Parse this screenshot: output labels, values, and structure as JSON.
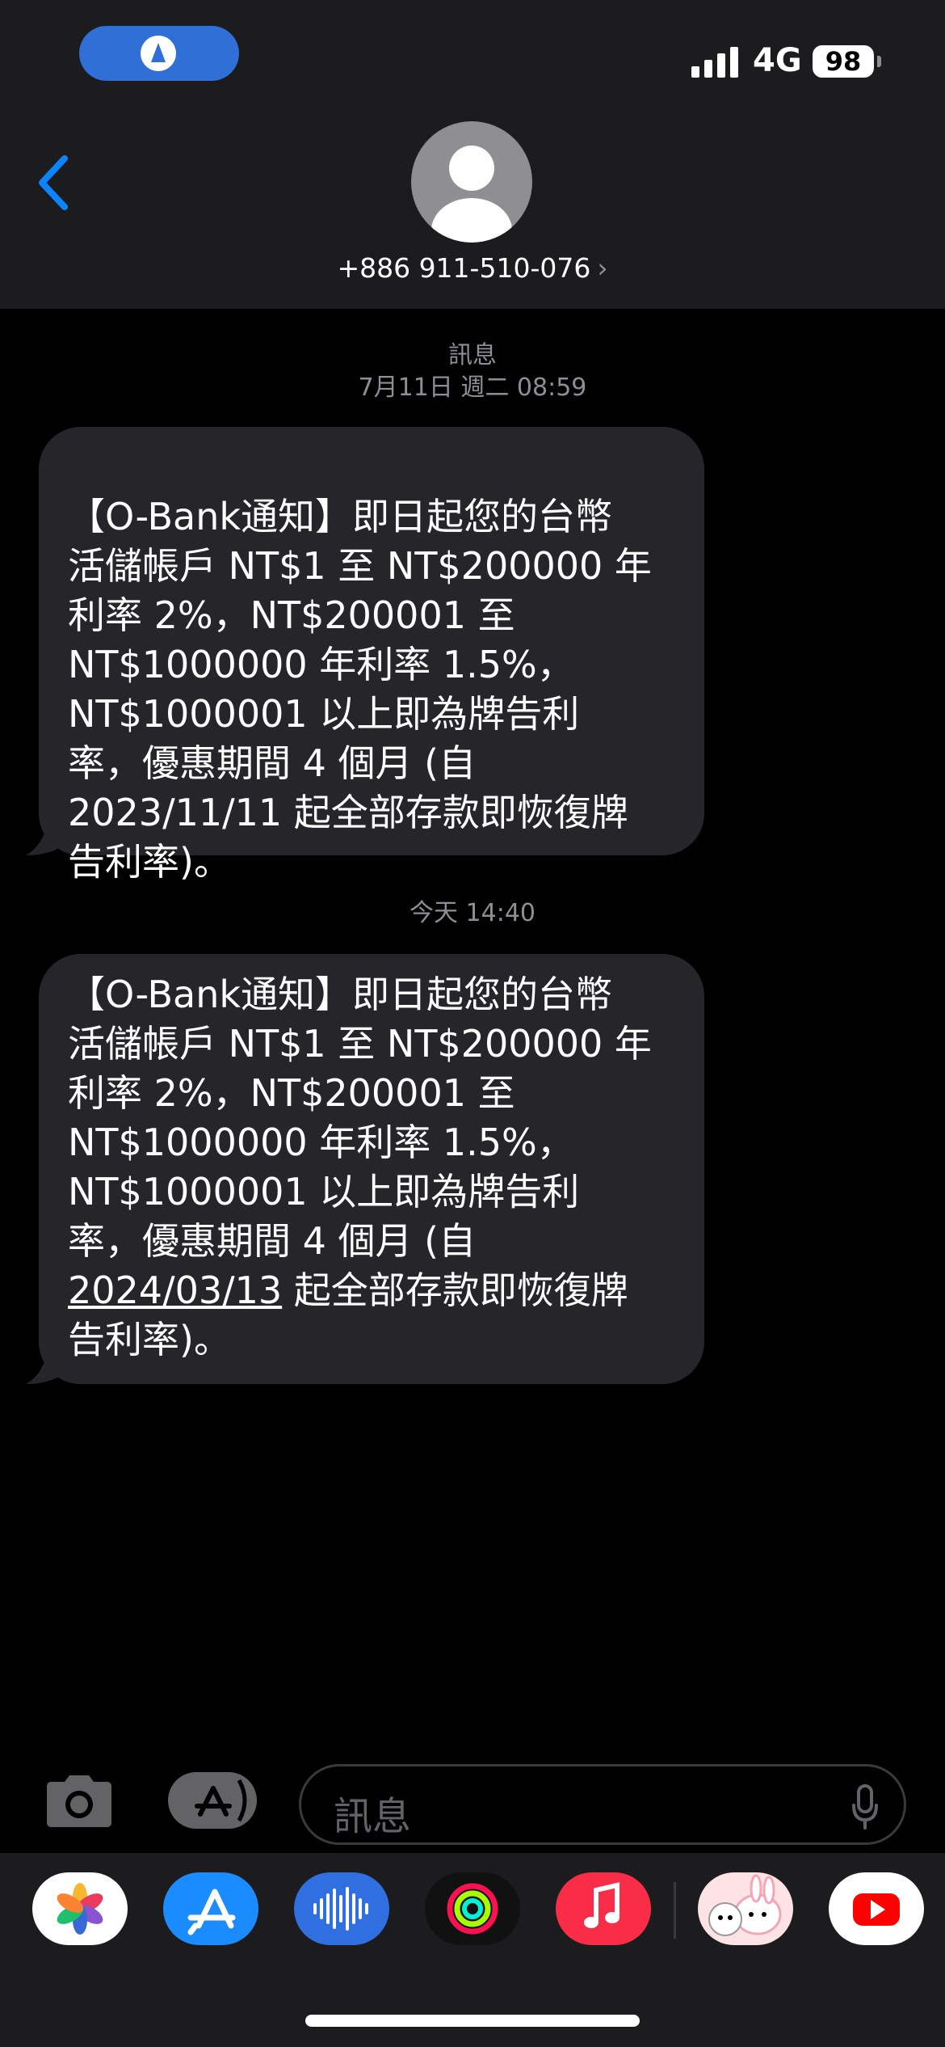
{
  "status_bar": {
    "network": "4G",
    "battery": "98"
  },
  "header": {
    "contact": "+886 911-510-076",
    "chevron": "›"
  },
  "messages": [
    {
      "service": "訊息",
      "timestamp": "7月11日 週二 08:59",
      "text": "【O-Bank通知】即日起您的台幣\n活儲帳戶 NT$1 至 NT$200000 年\n利率 2%，NT$200001 至\nNT$1000000 年利率 1.5%，\nNT$1000001 以上即為牌告利\n率，優惠期間 4 個月 (自\n2023/11/11 起全部存款即恢復牌\n告利率)。"
    },
    {
      "timestamp": "今天 14:40",
      "text_before": "【O-Bank通知】即日起您的台幣\n活儲帳戶 NT$1 至 NT$200000 年\n利率 2%，NT$200001 至\nNT$1000000 年利率 1.5%，\nNT$1000001 以上即為牌告利\n率，優惠期間 4 個月 (自\n",
      "link": "2024/03/13",
      "text_after": " 起全部存款即恢復牌\n告利率)。"
    }
  ],
  "composer": {
    "placeholder": "訊息"
  },
  "dock_apps": [
    "photos-icon",
    "app-store-icon",
    "voice-memos-icon",
    "fitness-icon",
    "music-icon",
    "sticker-icon",
    "youtube-icon"
  ],
  "colors": {
    "accent": "#0a84ff",
    "bubble": "#26252a",
    "header": "#1c1c1e"
  }
}
